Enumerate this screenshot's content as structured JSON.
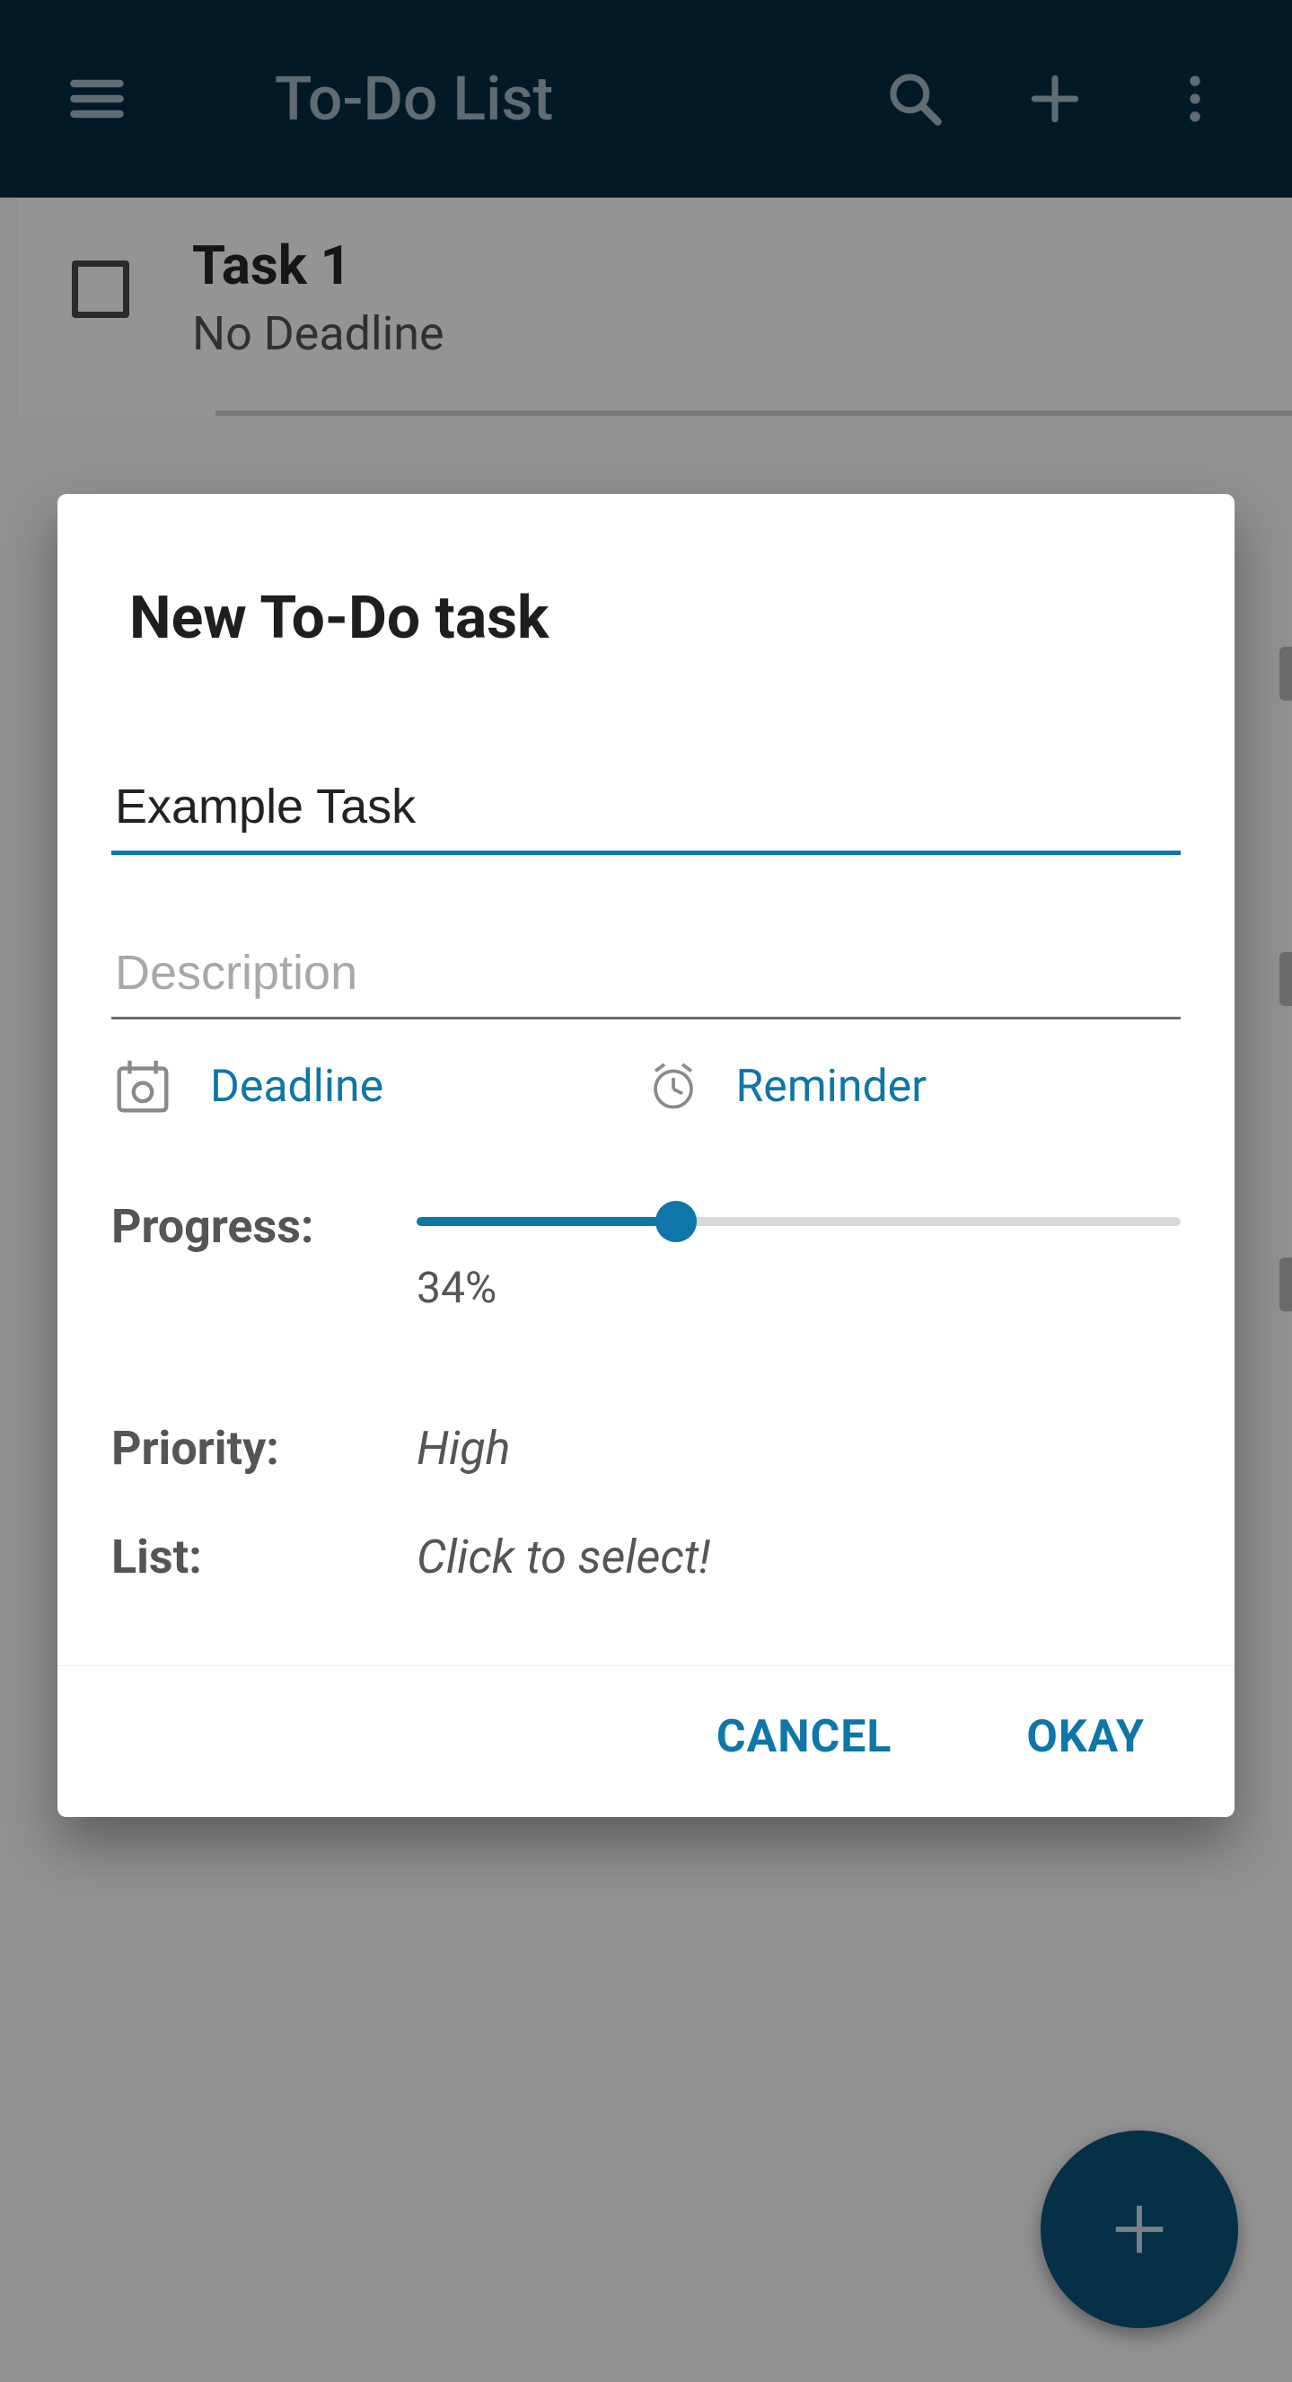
{
  "appbar": {
    "title": "To-Do List"
  },
  "tasks": [
    {
      "title": "Task 1",
      "subtitle": "No Deadline"
    }
  ],
  "dialog": {
    "title": "New To-Do task",
    "name_value": "Example Task",
    "desc_placeholder": "Description",
    "deadline_label": "Deadline",
    "reminder_label": "Reminder",
    "progress_label": "Progress:",
    "progress_pct": 34,
    "progress_text": "34%",
    "priority_label": "Priority:",
    "priority_value": "High",
    "list_label": "List:",
    "list_value": "Click to select!",
    "cancel": "CANCEL",
    "ok": "OKAY"
  },
  "colors": {
    "accent": "#0e76a8",
    "appbar_bg": "#062c42"
  }
}
